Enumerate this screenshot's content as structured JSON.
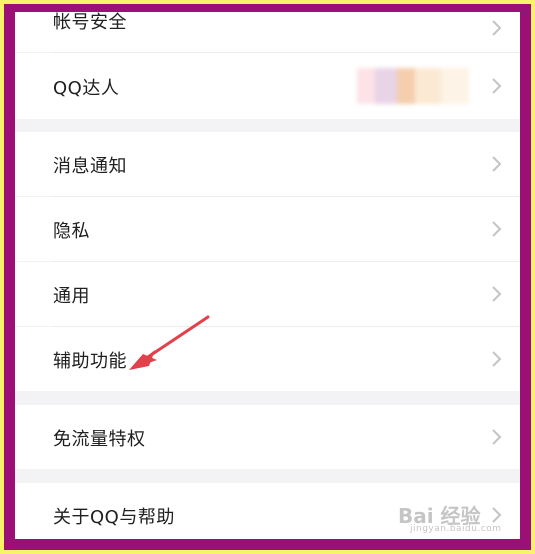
{
  "settings": {
    "items": [
      {
        "label": "帐号安全"
      },
      {
        "label": "QQ达人"
      },
      {
        "label": "消息通知"
      },
      {
        "label": "隐私"
      },
      {
        "label": "通用"
      },
      {
        "label": "辅助功能"
      },
      {
        "label": "免流量特权"
      },
      {
        "label": "关于QQ与帮助"
      }
    ]
  },
  "watermark": {
    "text": "Bai 经验",
    "sub": "jingyan.baidu.com"
  },
  "colors": {
    "outer_border": "#f7f36a",
    "inner_border": "#9a1074",
    "arrow": "#e2404a",
    "chevron": "#c4c4c4"
  },
  "icons": [
    "chevron-right-icon",
    "annotation-arrow-icon"
  ]
}
